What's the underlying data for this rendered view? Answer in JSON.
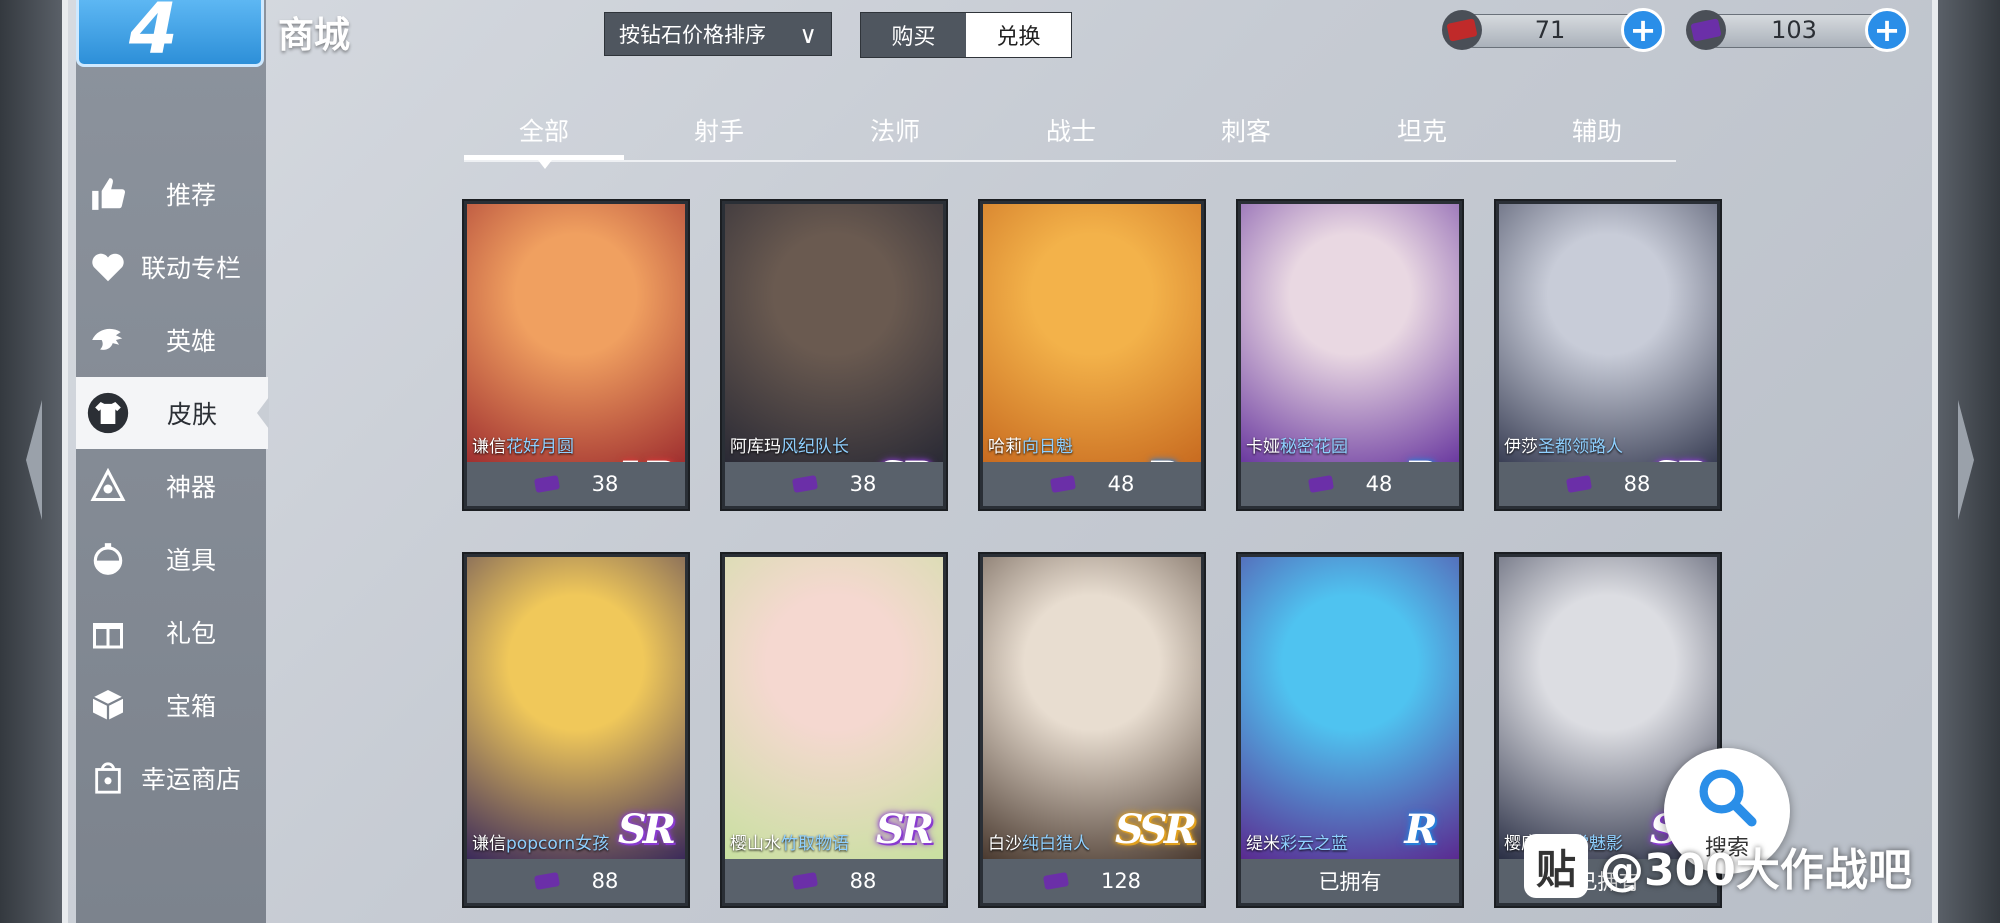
{
  "header": {
    "title": "商城",
    "logo_text": "4"
  },
  "sort": {
    "label": "按钻石价格排序"
  },
  "mode": {
    "buy": "购买",
    "exchange": "兑换",
    "selected": "兑换"
  },
  "currencies": [
    {
      "icon": "red-ticket-icon",
      "value": "71",
      "color": "#c02a2a"
    },
    {
      "icon": "purple-ticket-icon",
      "value": "103",
      "color": "#6b2fa8"
    }
  ],
  "sidebar": {
    "items": [
      {
        "label": "推荐",
        "icon": "thumbs-up-icon"
      },
      {
        "label": "联动专栏",
        "icon": "heart-icon"
      },
      {
        "label": "英雄",
        "icon": "hero-icon"
      },
      {
        "label": "皮肤",
        "icon": "shirt-icon",
        "active": true
      },
      {
        "label": "神器",
        "icon": "artifact-icon"
      },
      {
        "label": "道具",
        "icon": "potion-icon"
      },
      {
        "label": "礼包",
        "icon": "gift-icon"
      },
      {
        "label": "宝箱",
        "icon": "box-icon"
      },
      {
        "label": "幸运商店",
        "icon": "lucky-bag-icon"
      }
    ]
  },
  "tabs": [
    "全部",
    "射手",
    "法师",
    "战士",
    "刺客",
    "坦克",
    "辅助"
  ],
  "active_tab": "全部",
  "cards": [
    {
      "hero": "谦信",
      "skin": "花好月圆",
      "rarity": "LR",
      "price": "38",
      "palette": [
        "#f0a060",
        "#a03030"
      ]
    },
    {
      "hero": "阿库玛",
      "skin": "风纪队长",
      "rarity": "SR",
      "price": "38",
      "palette": [
        "#6a5a50",
        "#2a2a35"
      ]
    },
    {
      "hero": "哈莉",
      "skin": "向日魁",
      "rarity": "R",
      "price": "48",
      "palette": [
        "#f3b24a",
        "#c86b20"
      ]
    },
    {
      "hero": "卡娅",
      "skin": "秘密花园",
      "rarity": "R",
      "price": "48",
      "palette": [
        "#e9d8e2",
        "#6b3aa0"
      ]
    },
    {
      "hero": "伊莎",
      "skin": "圣都领路人",
      "rarity": "SR",
      "price": "88",
      "palette": [
        "#c8ccd8",
        "#3a3f55"
      ]
    },
    {
      "hero": "谦信",
      "skin": "popcorn女孩",
      "rarity": "SR",
      "price": "88",
      "palette": [
        "#f0c85a",
        "#3b2a5a"
      ]
    },
    {
      "hero": "樱山水",
      "skin": "竹取物语",
      "rarity": "SR",
      "price": "88",
      "palette": [
        "#f5d8d0",
        "#c8e0a0"
      ]
    },
    {
      "hero": "白沙",
      "skin": "纯白猎人",
      "rarity": "SSR",
      "price": "128",
      "palette": [
        "#e8ddd0",
        "#4a3a30"
      ]
    },
    {
      "hero": "缇米",
      "skin": "彩云之蓝",
      "rarity": "R",
      "price": "已拥有",
      "owned": true,
      "palette": [
        "#4fc3f0",
        "#5a2a90"
      ]
    },
    {
      "hero": "樱庭…",
      "skin": "教堂魅影",
      "rarity": "SR",
      "price": "已拥有",
      "owned": true,
      "palette": [
        "#dcdde2",
        "#2a2f45"
      ]
    }
  ],
  "search_fab": {
    "label": "搜索"
  },
  "watermark": {
    "logo": "贴",
    "text": "@300大作战吧"
  }
}
